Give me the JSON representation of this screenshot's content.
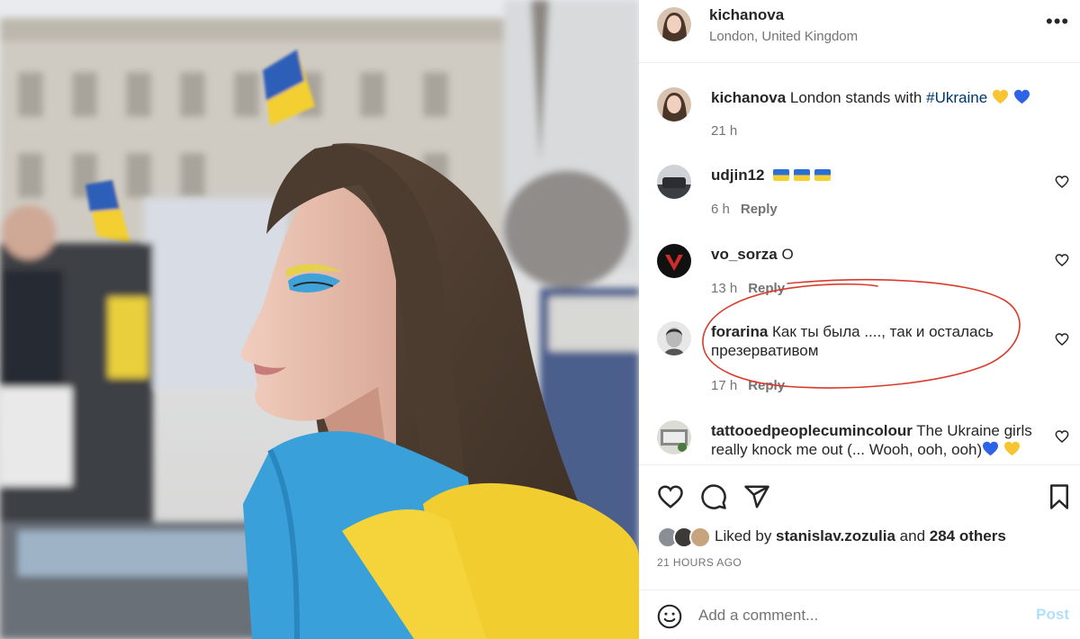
{
  "post": {
    "username": "kichanova",
    "location": "London, United Kingdom",
    "more_icon": "more-horizontal-icon"
  },
  "caption": {
    "username": "kichanova",
    "text_before": "London stands with ",
    "hashtag": "#Ukraine",
    "emojis": [
      "yellow-heart",
      "blue-heart"
    ],
    "time": "21 h"
  },
  "comments": [
    {
      "username": "udjin12",
      "text": "",
      "emojis": [
        "ukraine-flag",
        "ukraine-flag",
        "ukraine-flag"
      ],
      "time": "6 h",
      "reply": "Reply"
    },
    {
      "username": "vo_sorza",
      "text": "О",
      "time": "13 h",
      "reply": "Reply"
    },
    {
      "username": "forarina",
      "text": "Как ты была ...., так и осталась презервативом",
      "time": "17 h",
      "reply": "Reply"
    },
    {
      "username": "tattooedpeoplecumincolour",
      "text": "The Ukraine girls really knock me out (... Wooh, ooh, ooh)",
      "emojis": [
        "blue-heart",
        "yellow-heart"
      ]
    }
  ],
  "likes": {
    "prefix": "Liked by ",
    "user": "stanislav.zozulia",
    "middle": " and ",
    "others": "284 others"
  },
  "timestamp": "21 HOURS AGO",
  "add_comment": {
    "placeholder": "Add a comment...",
    "post_label": "Post"
  },
  "colors": {
    "link": "#00376b",
    "post_disabled": "#b2dffc",
    "annotation": "#d93a2b",
    "ukraine_blue": "#2b6fd6",
    "ukraine_yellow": "#f4cf35"
  }
}
